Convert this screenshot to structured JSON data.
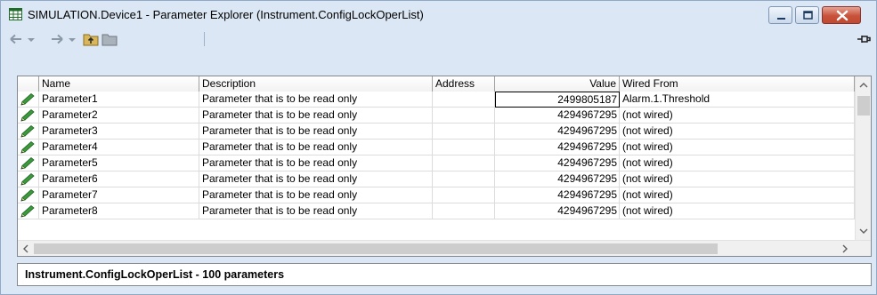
{
  "window": {
    "title": "SIMULATION.Device1 - Parameter Explorer (Instrument.ConfigLockOperList)"
  },
  "toolbar": {
    "items": [
      "back-icon",
      "back-dropdown-icon",
      "forward-icon",
      "forward-dropdown-icon",
      "folder-up-icon",
      "folder-icon",
      "pin-icon"
    ]
  },
  "table": {
    "columns": {
      "name": "Name",
      "description": "Description",
      "address": "Address",
      "value": "Value",
      "wired_from": "Wired From"
    },
    "rows": [
      {
        "name": "Parameter1",
        "description": "Parameter that is to be read only",
        "address": "",
        "value": "2499805187",
        "wired_from": "Alarm.1.Threshold"
      },
      {
        "name": "Parameter2",
        "description": "Parameter that is to be read only",
        "address": "",
        "value": "4294967295",
        "wired_from": "(not wired)"
      },
      {
        "name": "Parameter3",
        "description": "Parameter that is to be read only",
        "address": "",
        "value": "4294967295",
        "wired_from": "(not wired)"
      },
      {
        "name": "Parameter4",
        "description": "Parameter that is to be read only",
        "address": "",
        "value": "4294967295",
        "wired_from": "(not wired)"
      },
      {
        "name": "Parameter5",
        "description": "Parameter that is to be read only",
        "address": "",
        "value": "4294967295",
        "wired_from": "(not wired)"
      },
      {
        "name": "Parameter6",
        "description": "Parameter that is to be read only",
        "address": "",
        "value": "4294967295",
        "wired_from": "(not wired)"
      },
      {
        "name": "Parameter7",
        "description": "Parameter that is to be read only",
        "address": "",
        "value": "4294967295",
        "wired_from": "(not wired)"
      },
      {
        "name": "Parameter8",
        "description": "Parameter that is to be read only",
        "address": "",
        "value": "4294967295",
        "wired_from": "(not wired)"
      }
    ]
  },
  "status": {
    "text": "Instrument.ConfigLockOperList  -  100 parameters"
  },
  "colors": {
    "titlebar": "#dbe7f4",
    "close_button": "#c8523b",
    "grid_border": "#828790",
    "pencil_green": "#2e8b2e"
  }
}
